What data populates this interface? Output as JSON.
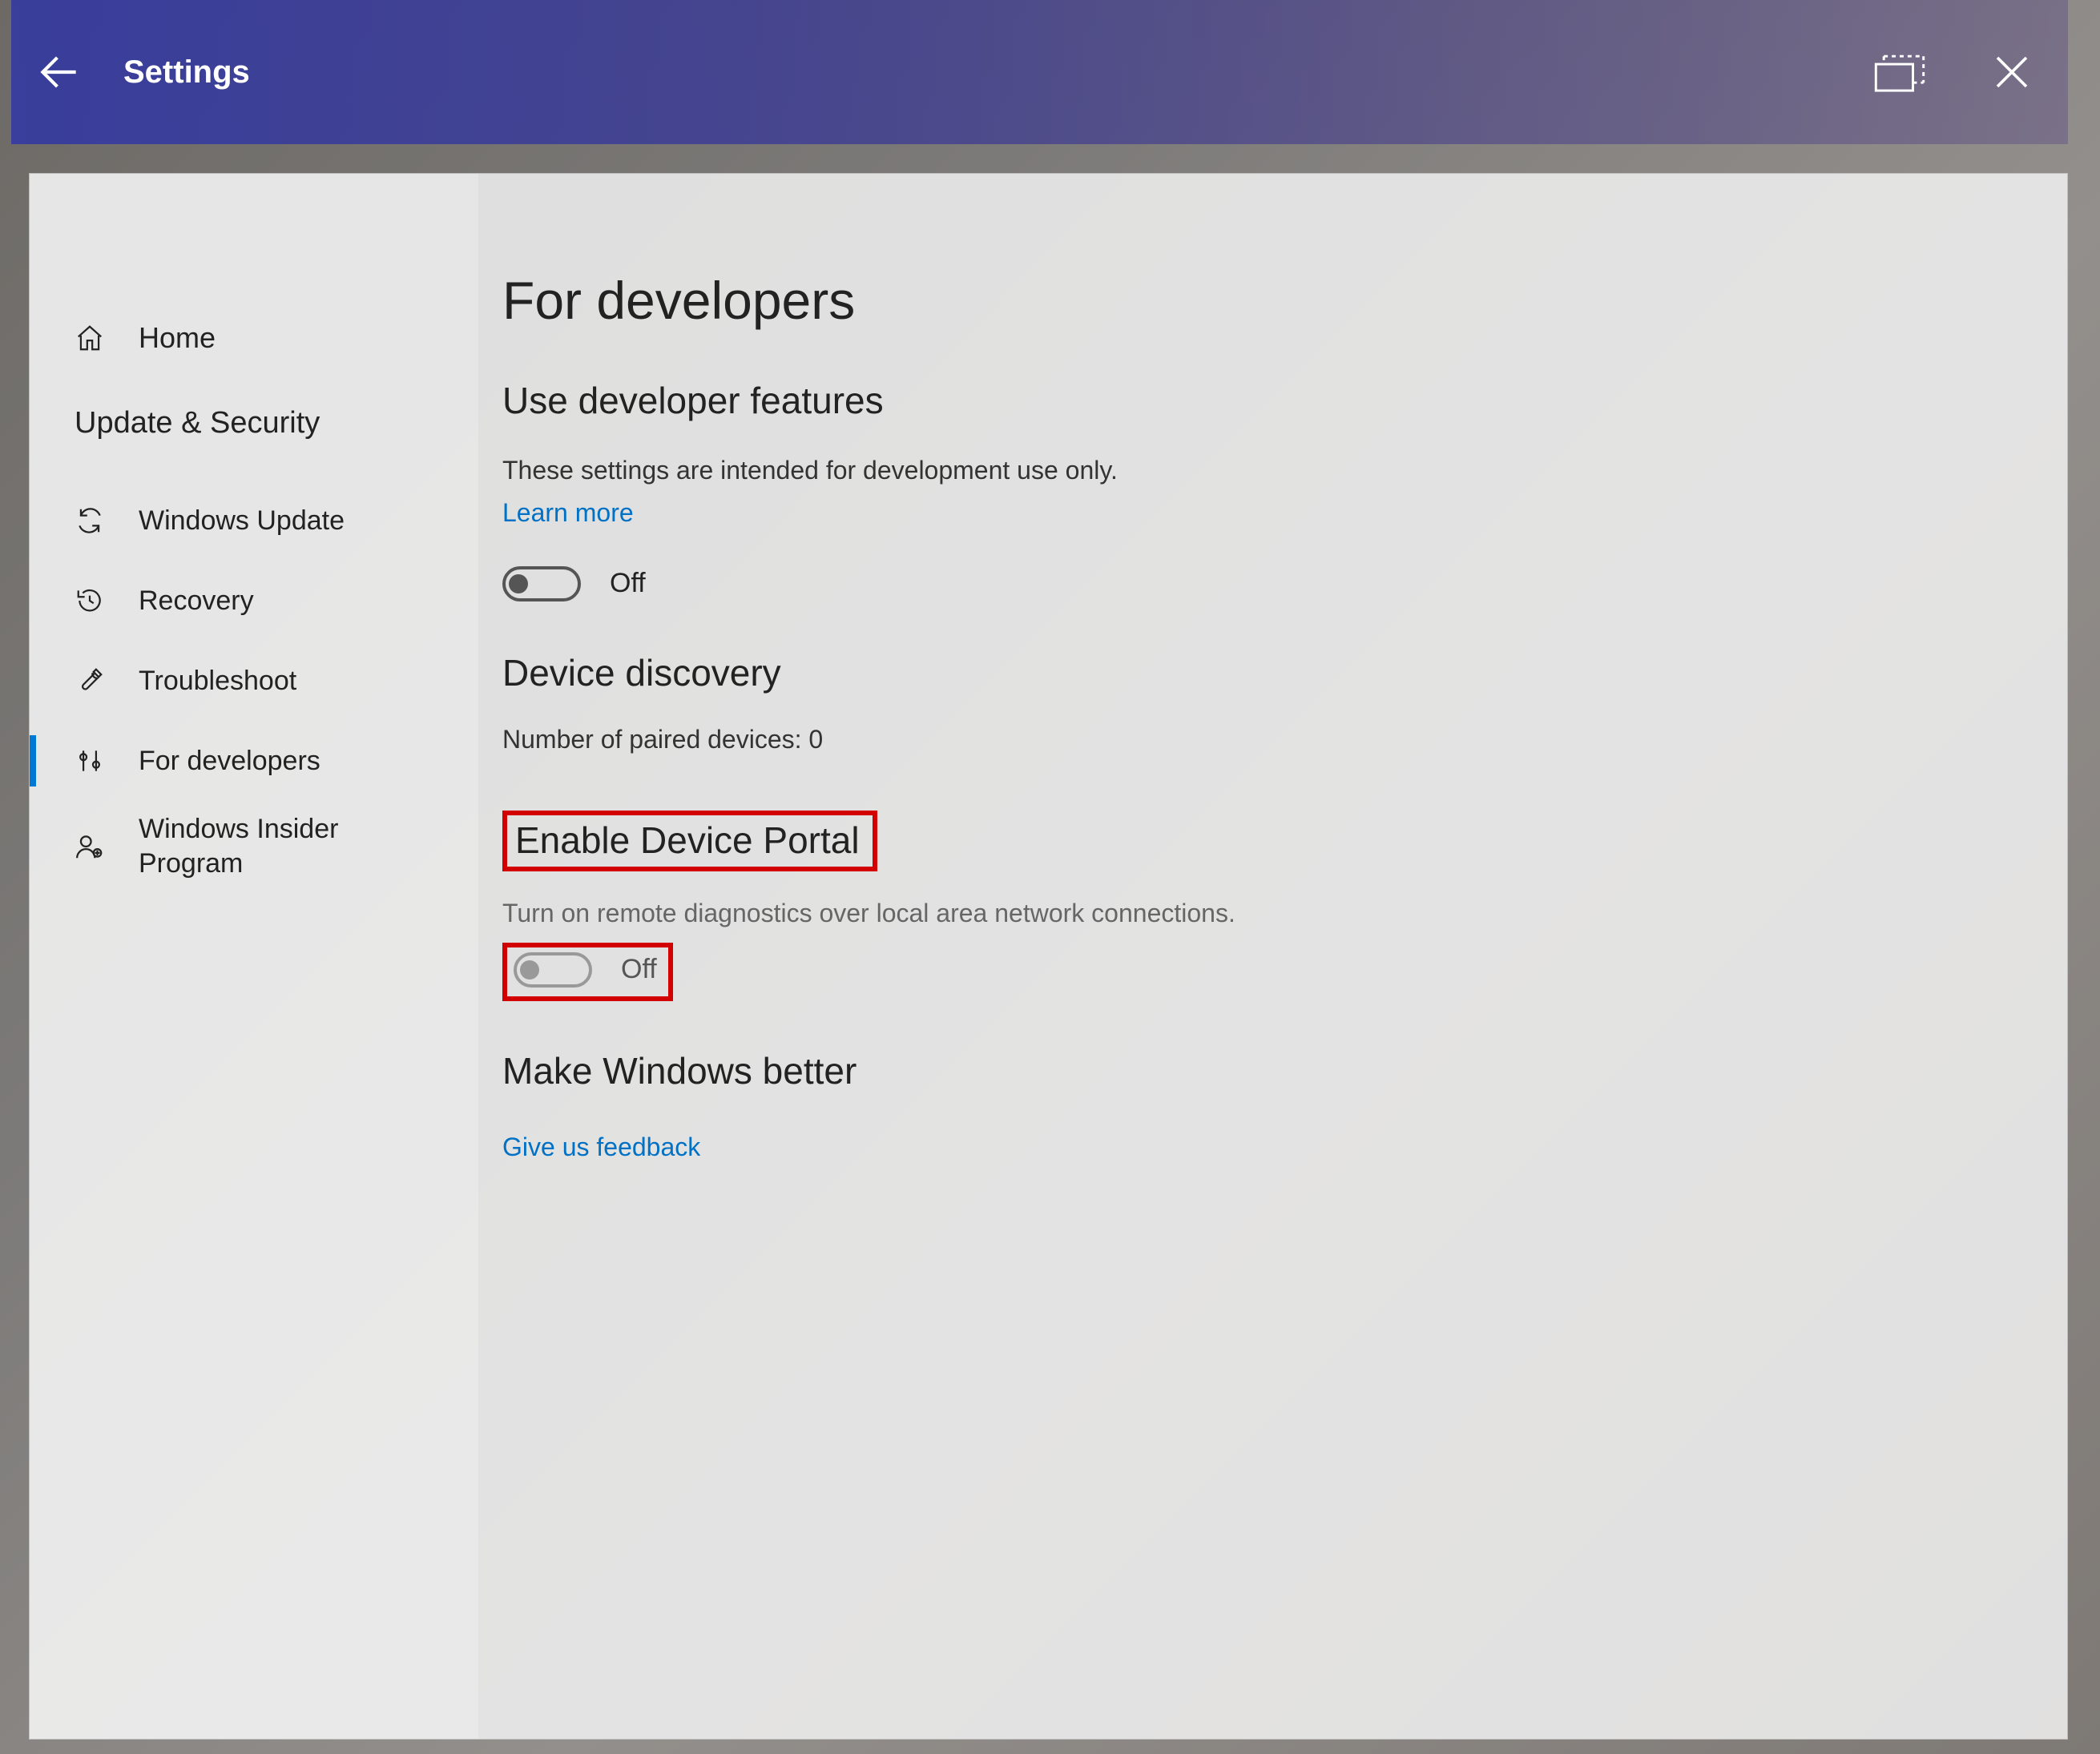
{
  "header": {
    "title": "Settings"
  },
  "sidebar": {
    "home": "Home",
    "category": "Update & Security",
    "items": [
      {
        "label": "Windows Update"
      },
      {
        "label": "Recovery"
      },
      {
        "label": "Troubleshoot"
      },
      {
        "label": "For developers"
      },
      {
        "label": "Windows Insider Program"
      }
    ]
  },
  "main": {
    "title": "For developers",
    "section1": {
      "heading": "Use developer features",
      "desc": "These settings are intended for development use only.",
      "learn_more": "Learn more",
      "toggle_label": "Off"
    },
    "section2": {
      "heading": "Device discovery",
      "paired": "Number of paired devices: 0"
    },
    "section3": {
      "heading": "Enable Device Portal",
      "desc": "Turn on remote diagnostics over local area network connections.",
      "toggle_label": "Off"
    },
    "section4": {
      "heading": "Make Windows better",
      "feedback": "Give us feedback"
    }
  },
  "highlight_color": "#d20000"
}
